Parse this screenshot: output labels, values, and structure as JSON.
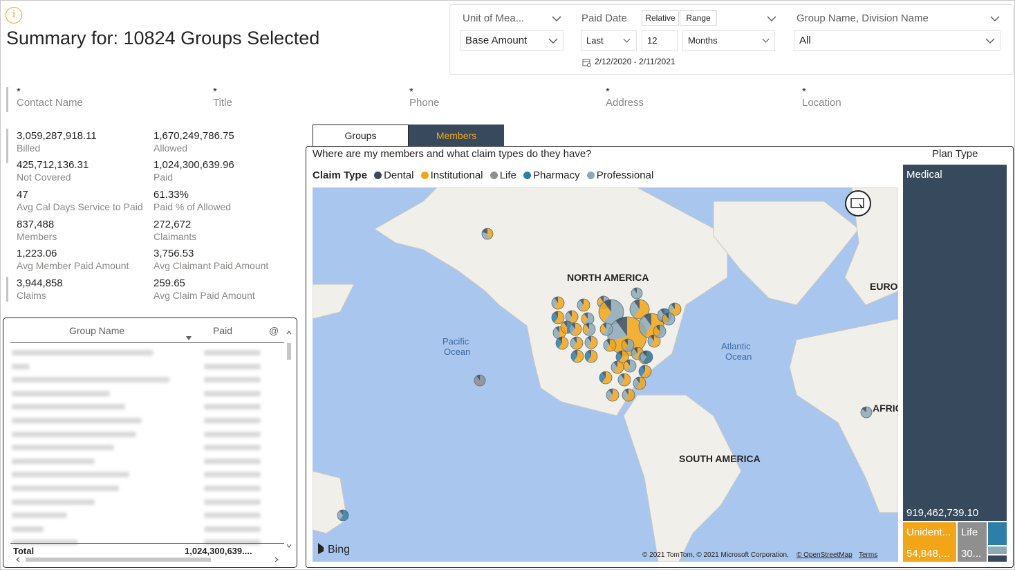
{
  "page": {
    "title": "Summary for: 10824 Groups Selected",
    "info_icon": "info-icon"
  },
  "filters": {
    "unit_of_measure": {
      "header": "Unit of Mea...",
      "value": "Base Amount"
    },
    "paid_date": {
      "header": "Paid Date",
      "relative_label": "Relative",
      "range_label": "Range",
      "period": "Last",
      "count": "12",
      "unit": "Months",
      "date_range": "2/12/2020 - 2/11/2021"
    },
    "group_division": {
      "header": "Group Name, Division Name",
      "value": "All"
    }
  },
  "contact": {
    "fields": [
      {
        "star": "*",
        "label": "Contact Name"
      },
      {
        "star": "*",
        "label": "Title"
      },
      {
        "star": "*",
        "label": "Phone"
      },
      {
        "star": "*",
        "label": "Address"
      },
      {
        "star": "*",
        "label": "Location"
      }
    ]
  },
  "kpis": [
    {
      "value": "3,059,287,918.11",
      "label": "Billed"
    },
    {
      "value": "1,670,249,786.75",
      "label": "Allowed"
    },
    {
      "value": "425,712,136.31",
      "label": "Not Covered"
    },
    {
      "value": "1,024,300,639.96",
      "label": "Paid"
    },
    {
      "value": "47",
      "label": "Avg Cal Days Service to Paid"
    },
    {
      "value": "61.33%",
      "label": "Paid % of Allowed"
    },
    {
      "value": "837,488",
      "label": "Members"
    },
    {
      "value": "272,672",
      "label": "Claimants"
    },
    {
      "value": "1,223.06",
      "label": "Avg Member Paid Amount"
    },
    {
      "value": "3,756.53",
      "label": "Avg Claimant Paid Amount"
    },
    {
      "value": "3,944,858",
      "label": "Claims"
    },
    {
      "value": "259.65",
      "label": "Avg Claim Paid Amount"
    }
  ],
  "table": {
    "columns": [
      "Group Name",
      "Paid",
      "@"
    ],
    "total_label": "Total",
    "total_value": "1,024,300,639...."
  },
  "tabs": [
    {
      "label": "Groups",
      "active": false
    },
    {
      "label": "Members",
      "active": true
    }
  ],
  "map": {
    "question": "Where are my members and what claim types do they have?",
    "legend_title": "Claim Type",
    "legend": [
      {
        "name": "Dental",
        "color": "#374a5d"
      },
      {
        "name": "Institutional",
        "color": "#f2a516"
      },
      {
        "name": "Life",
        "color": "#8f8f8f"
      },
      {
        "name": "Pharmacy",
        "color": "#2d7ea8"
      },
      {
        "name": "Professional",
        "color": "#8da9b7"
      }
    ],
    "labels": {
      "north_america": "NORTH AMERICA",
      "south_america": "SOUTH AMERICA",
      "europe": "EUROP",
      "africa": "AFRIC",
      "pacific_1": "Pacific",
      "pacific_2": "Ocean",
      "atlantic_1": "Atlantic",
      "atlantic_2": "Ocean"
    },
    "bing": "Bing",
    "attribution": "© 2021 TomTom, © 2021 Microsoft Corporation,",
    "osm": "© OpenStreetMap",
    "terms": "Terms"
  },
  "plan_type": {
    "title": "Plan Type",
    "medical_label": "Medical",
    "medical_value": "919,462,739.10",
    "unident_label": "Unident...",
    "unident_value": "54,848,...",
    "life_label": "Life",
    "life_value": "30...",
    "colors": {
      "medical": "#374a5d",
      "unident": "#f2a516",
      "life": "#8f8f8f",
      "small1": "#2d7ea8",
      "small2": "#8da9b7",
      "small3": "#374a5d"
    }
  }
}
